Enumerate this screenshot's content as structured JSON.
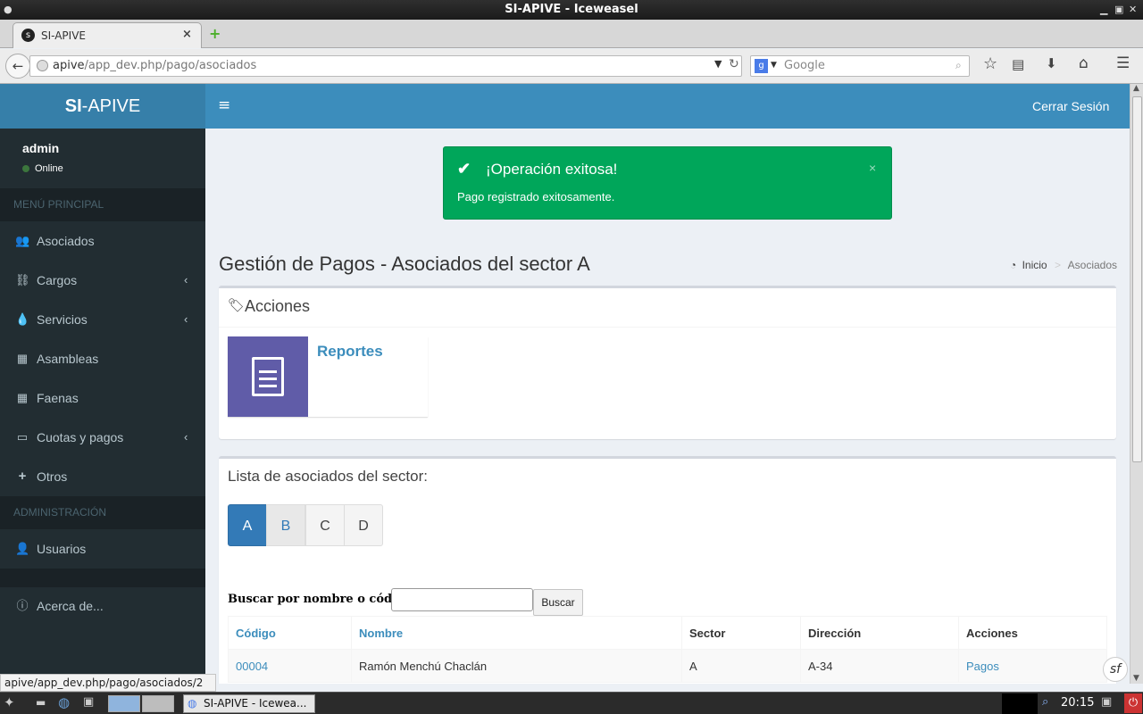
{
  "window": {
    "title": "SI-APIVE - Iceweasel"
  },
  "browser": {
    "tab_title": "SI-APIVE",
    "url_host": "apive",
    "url_path": "/app_dev.php/pago/asociados",
    "search_placeholder": "Google",
    "status_url": "apive/app_dev.php/pago/asociados/2"
  },
  "sidebar": {
    "logo_bold": "SI",
    "logo_rest": "-APIVE",
    "user_name": "admin",
    "user_status": "Online",
    "header_main": "MENÚ PRINCIPAL",
    "items": [
      {
        "label": "Asociados",
        "icon": "users-icon"
      },
      {
        "label": "Cargos",
        "icon": "sitemap-icon"
      },
      {
        "label": "Servicios",
        "icon": "tint-icon"
      },
      {
        "label": "Asambleas",
        "icon": "calendar-icon"
      },
      {
        "label": "Faenas",
        "icon": "calendar-icon"
      },
      {
        "label": "Cuotas y pagos",
        "icon": "money-icon"
      },
      {
        "label": "Otros",
        "icon": "plus-icon"
      }
    ],
    "header_admin": "ADMINISTRACIÓN",
    "admin_items": [
      {
        "label": "Usuarios",
        "icon": "user-icon"
      }
    ],
    "about": {
      "label": "Acerca de...",
      "icon": "info-icon"
    }
  },
  "topnav": {
    "logout": "Cerrar Sesión"
  },
  "alert": {
    "title": "¡Operación exitosa!",
    "message": "Pago registrado exitosamente."
  },
  "page": {
    "title": "Gestión de Pagos - Asociados del sector A",
    "breadcrumb": {
      "home": "Inicio",
      "current": "Asociados"
    }
  },
  "actions_box": {
    "title": "Acciones",
    "tile_label": "Reportes"
  },
  "list_box": {
    "title": "Lista de asociados del sector:",
    "sectors": [
      "A",
      "B",
      "C",
      "D"
    ],
    "active_sector": "A",
    "search_label": "Buscar por nombre o código:",
    "search_value": "",
    "search_button": "Buscar",
    "columns": [
      "Código",
      "Nombre",
      "Sector",
      "Dirección",
      "Acciones"
    ],
    "rows": [
      {
        "code": "00004",
        "name": "Ramón Menchú Chaclán",
        "sector": "A",
        "address": "A-34",
        "action": "Pagos"
      }
    ]
  },
  "taskbar": {
    "window_label": "SI-APIVE - Icewea...",
    "clock": "20:15"
  },
  "colors": {
    "primary": "#3c8dbc",
    "logo_bg": "#367fa9",
    "sidebar": "#222d32",
    "success": "#00a65a",
    "tile": "#605ca8"
  }
}
